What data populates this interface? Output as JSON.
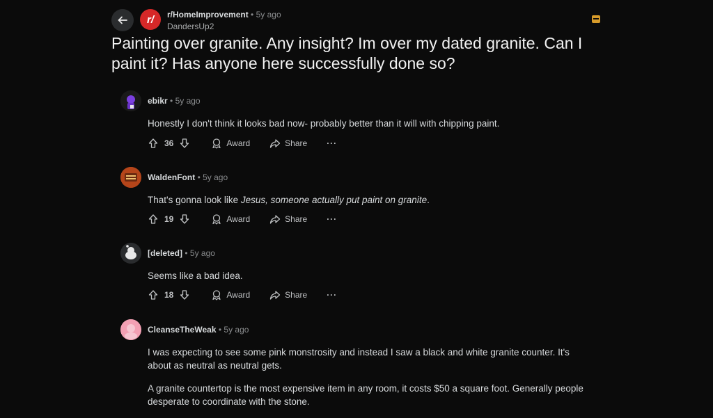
{
  "header": {
    "subreddit": "r/HomeImprovement",
    "sub_initial": "r/",
    "dot": "•",
    "time": "5y ago",
    "username": "DandersUp2"
  },
  "post": {
    "title": "Painting over granite. Any insight? Im over my dated granite. Can I paint it? Has anyone here successfully done so?"
  },
  "actions": {
    "award": "Award",
    "share": "Share",
    "more": "···"
  },
  "comments": [
    {
      "author": "ebikr",
      "time": "5y ago",
      "body": "Honestly I don't think it looks bad now- probably better than it will with chipping paint.",
      "votes": "36"
    },
    {
      "author": "WaldenFont",
      "time": "5y ago",
      "body_pre": "That's gonna look like ",
      "body_em": "Jesus, someone actually put paint on granite",
      "body_post": ".",
      "votes": "19"
    },
    {
      "author": "[deleted]",
      "time": "5y ago",
      "body": "Seems like a bad idea.",
      "votes": "18"
    },
    {
      "author": "CleanseTheWeak",
      "time": "5y ago",
      "body_p1": "I was expecting to see some pink monstrosity and instead I saw a black and white granite counter. It's about as neutral as neutral gets.",
      "body_p2": "A granite countertop is the most expensive item in any room, it costs $50 a square foot. Generally people desperate to coordinate with the stone."
    }
  ],
  "colors": {
    "background": "#0b0b0b",
    "subreddit_red": "#d62828",
    "accent_orange": "#d79b2a"
  }
}
